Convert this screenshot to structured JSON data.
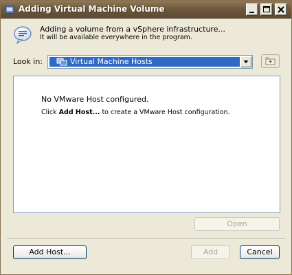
{
  "window": {
    "title": "Adding Virtual Machine Volume"
  },
  "header": {
    "title": "Adding a volume from a vSphere infrastructure...",
    "subtitle": "It will be available everywhere in the program."
  },
  "lookin": {
    "label": "Look in:",
    "selected": "Virtual Machine Hosts"
  },
  "content": {
    "no_host": "No VMware Host configured.",
    "click_prefix": "Click ",
    "click_bold": "Add Host...",
    "click_suffix": " to create a VMware Host configuration."
  },
  "buttons": {
    "open": "Open",
    "add_host": "Add Host...",
    "add": "Add",
    "cancel": "Cancel"
  },
  "colors": {
    "titlebar": "#6f5a3f",
    "selection": "#316ac5",
    "dialog_bg": "#ece9d8"
  }
}
